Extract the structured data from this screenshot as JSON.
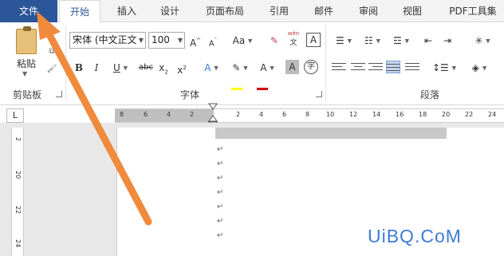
{
  "tabs": [
    "文件",
    "开始",
    "插入",
    "设计",
    "页面布局",
    "引用",
    "邮件",
    "审阅",
    "视图",
    "PDF工具集"
  ],
  "clipboard": {
    "paste_label": "粘贴",
    "group_label": "剪贴板"
  },
  "font": {
    "font_name": "宋体 (中文正文",
    "font_size": "100",
    "grow": "A",
    "shrink": "A",
    "case": "Aa",
    "phonetic": "wén",
    "phonetic_char": "文",
    "border_char": "A",
    "bold": "B",
    "italic": "I",
    "underline": "U",
    "strike": "abc",
    "subscript": "x",
    "subscript_mark": "2",
    "superscript": "x",
    "superscript_mark": "2",
    "effects": "A",
    "font_color": "A",
    "shading": "A",
    "enclose": "字",
    "group_label": "字体",
    "highlight_color": "#ffff00",
    "font_color_value": "#d00000"
  },
  "paragraph": {
    "group_label": "段落"
  },
  "ruler": {
    "corner": "L",
    "ticks": [
      "8",
      "6",
      "4",
      "2",
      "",
      "2",
      "4",
      "6",
      "8",
      "10",
      "12",
      "14",
      "16",
      "18",
      "20",
      "22",
      "24"
    ],
    "vticks": [
      "2",
      "20",
      "22",
      "24"
    ]
  },
  "watermark": "UiBQ.CoM",
  "paragraph_mark": "↵",
  "accent": "#2b579a",
  "arrow_color": "#f08a3c"
}
